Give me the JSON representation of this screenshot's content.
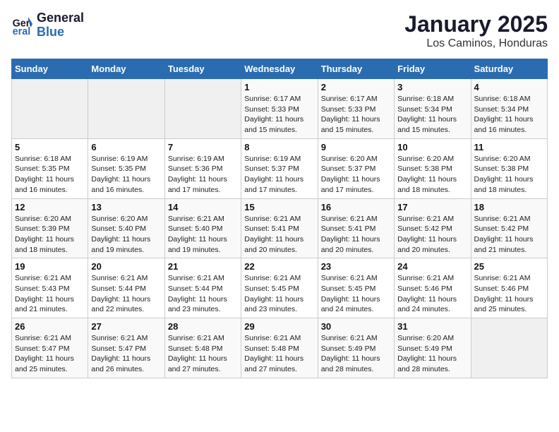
{
  "logo": {
    "text_general": "General",
    "text_blue": "Blue"
  },
  "title": "January 2025",
  "subtitle": "Los Caminos, Honduras",
  "weekdays": [
    "Sunday",
    "Monday",
    "Tuesday",
    "Wednesday",
    "Thursday",
    "Friday",
    "Saturday"
  ],
  "weeks": [
    [
      {
        "day": "",
        "info": ""
      },
      {
        "day": "",
        "info": ""
      },
      {
        "day": "",
        "info": ""
      },
      {
        "day": "1",
        "info": "Sunrise: 6:17 AM\nSunset: 5:33 PM\nDaylight: 11 hours and 15 minutes."
      },
      {
        "day": "2",
        "info": "Sunrise: 6:17 AM\nSunset: 5:33 PM\nDaylight: 11 hours and 15 minutes."
      },
      {
        "day": "3",
        "info": "Sunrise: 6:18 AM\nSunset: 5:34 PM\nDaylight: 11 hours and 15 minutes."
      },
      {
        "day": "4",
        "info": "Sunrise: 6:18 AM\nSunset: 5:34 PM\nDaylight: 11 hours and 16 minutes."
      }
    ],
    [
      {
        "day": "5",
        "info": "Sunrise: 6:18 AM\nSunset: 5:35 PM\nDaylight: 11 hours and 16 minutes."
      },
      {
        "day": "6",
        "info": "Sunrise: 6:19 AM\nSunset: 5:35 PM\nDaylight: 11 hours and 16 minutes."
      },
      {
        "day": "7",
        "info": "Sunrise: 6:19 AM\nSunset: 5:36 PM\nDaylight: 11 hours and 17 minutes."
      },
      {
        "day": "8",
        "info": "Sunrise: 6:19 AM\nSunset: 5:37 PM\nDaylight: 11 hours and 17 minutes."
      },
      {
        "day": "9",
        "info": "Sunrise: 6:20 AM\nSunset: 5:37 PM\nDaylight: 11 hours and 17 minutes."
      },
      {
        "day": "10",
        "info": "Sunrise: 6:20 AM\nSunset: 5:38 PM\nDaylight: 11 hours and 18 minutes."
      },
      {
        "day": "11",
        "info": "Sunrise: 6:20 AM\nSunset: 5:38 PM\nDaylight: 11 hours and 18 minutes."
      }
    ],
    [
      {
        "day": "12",
        "info": "Sunrise: 6:20 AM\nSunset: 5:39 PM\nDaylight: 11 hours and 18 minutes."
      },
      {
        "day": "13",
        "info": "Sunrise: 6:20 AM\nSunset: 5:40 PM\nDaylight: 11 hours and 19 minutes."
      },
      {
        "day": "14",
        "info": "Sunrise: 6:21 AM\nSunset: 5:40 PM\nDaylight: 11 hours and 19 minutes."
      },
      {
        "day": "15",
        "info": "Sunrise: 6:21 AM\nSunset: 5:41 PM\nDaylight: 11 hours and 20 minutes."
      },
      {
        "day": "16",
        "info": "Sunrise: 6:21 AM\nSunset: 5:41 PM\nDaylight: 11 hours and 20 minutes."
      },
      {
        "day": "17",
        "info": "Sunrise: 6:21 AM\nSunset: 5:42 PM\nDaylight: 11 hours and 20 minutes."
      },
      {
        "day": "18",
        "info": "Sunrise: 6:21 AM\nSunset: 5:42 PM\nDaylight: 11 hours and 21 minutes."
      }
    ],
    [
      {
        "day": "19",
        "info": "Sunrise: 6:21 AM\nSunset: 5:43 PM\nDaylight: 11 hours and 21 minutes."
      },
      {
        "day": "20",
        "info": "Sunrise: 6:21 AM\nSunset: 5:44 PM\nDaylight: 11 hours and 22 minutes."
      },
      {
        "day": "21",
        "info": "Sunrise: 6:21 AM\nSunset: 5:44 PM\nDaylight: 11 hours and 23 minutes."
      },
      {
        "day": "22",
        "info": "Sunrise: 6:21 AM\nSunset: 5:45 PM\nDaylight: 11 hours and 23 minutes."
      },
      {
        "day": "23",
        "info": "Sunrise: 6:21 AM\nSunset: 5:45 PM\nDaylight: 11 hours and 24 minutes."
      },
      {
        "day": "24",
        "info": "Sunrise: 6:21 AM\nSunset: 5:46 PM\nDaylight: 11 hours and 24 minutes."
      },
      {
        "day": "25",
        "info": "Sunrise: 6:21 AM\nSunset: 5:46 PM\nDaylight: 11 hours and 25 minutes."
      }
    ],
    [
      {
        "day": "26",
        "info": "Sunrise: 6:21 AM\nSunset: 5:47 PM\nDaylight: 11 hours and 25 minutes."
      },
      {
        "day": "27",
        "info": "Sunrise: 6:21 AM\nSunset: 5:47 PM\nDaylight: 11 hours and 26 minutes."
      },
      {
        "day": "28",
        "info": "Sunrise: 6:21 AM\nSunset: 5:48 PM\nDaylight: 11 hours and 27 minutes."
      },
      {
        "day": "29",
        "info": "Sunrise: 6:21 AM\nSunset: 5:48 PM\nDaylight: 11 hours and 27 minutes."
      },
      {
        "day": "30",
        "info": "Sunrise: 6:21 AM\nSunset: 5:49 PM\nDaylight: 11 hours and 28 minutes."
      },
      {
        "day": "31",
        "info": "Sunrise: 6:20 AM\nSunset: 5:49 PM\nDaylight: 11 hours and 28 minutes."
      },
      {
        "day": "",
        "info": ""
      }
    ]
  ]
}
